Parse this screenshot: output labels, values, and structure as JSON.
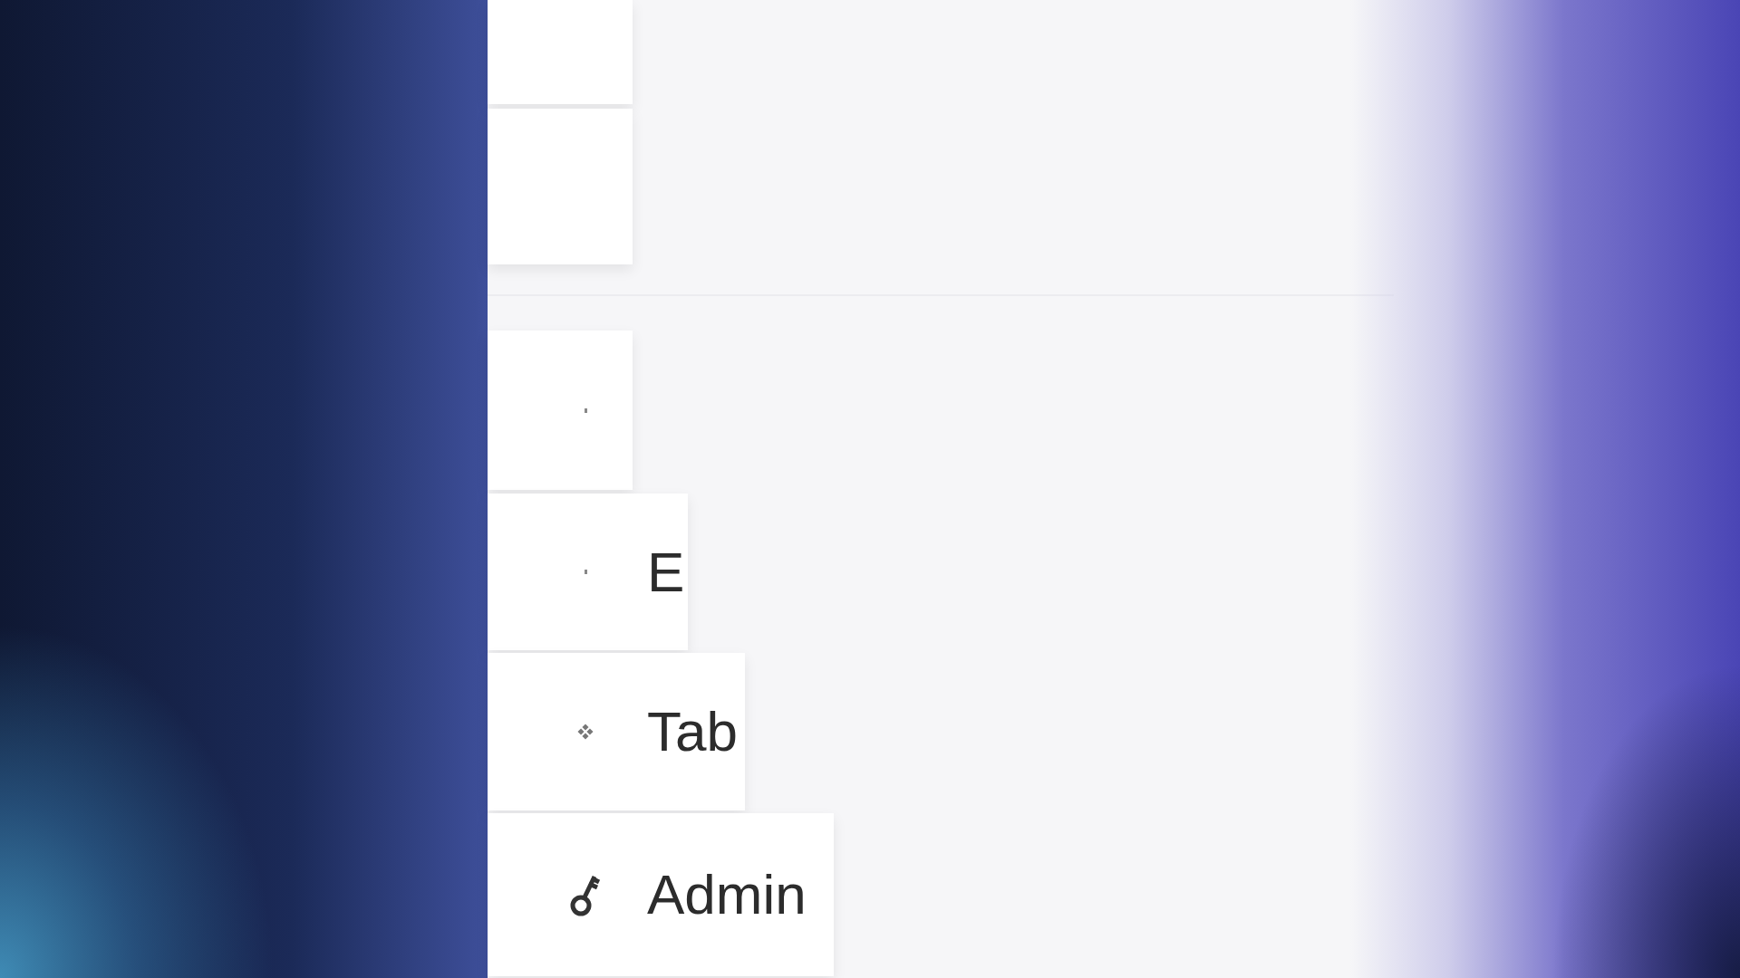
{
  "menu_items": [
    {
      "kind": "blank"
    },
    {
      "kind": "blank"
    },
    {
      "kind": "dot"
    },
    {
      "kind": "dot",
      "label": "E"
    },
    {
      "kind": "grid",
      "label": "Tab"
    },
    {
      "kind": "key",
      "label": "Admin"
    }
  ]
}
